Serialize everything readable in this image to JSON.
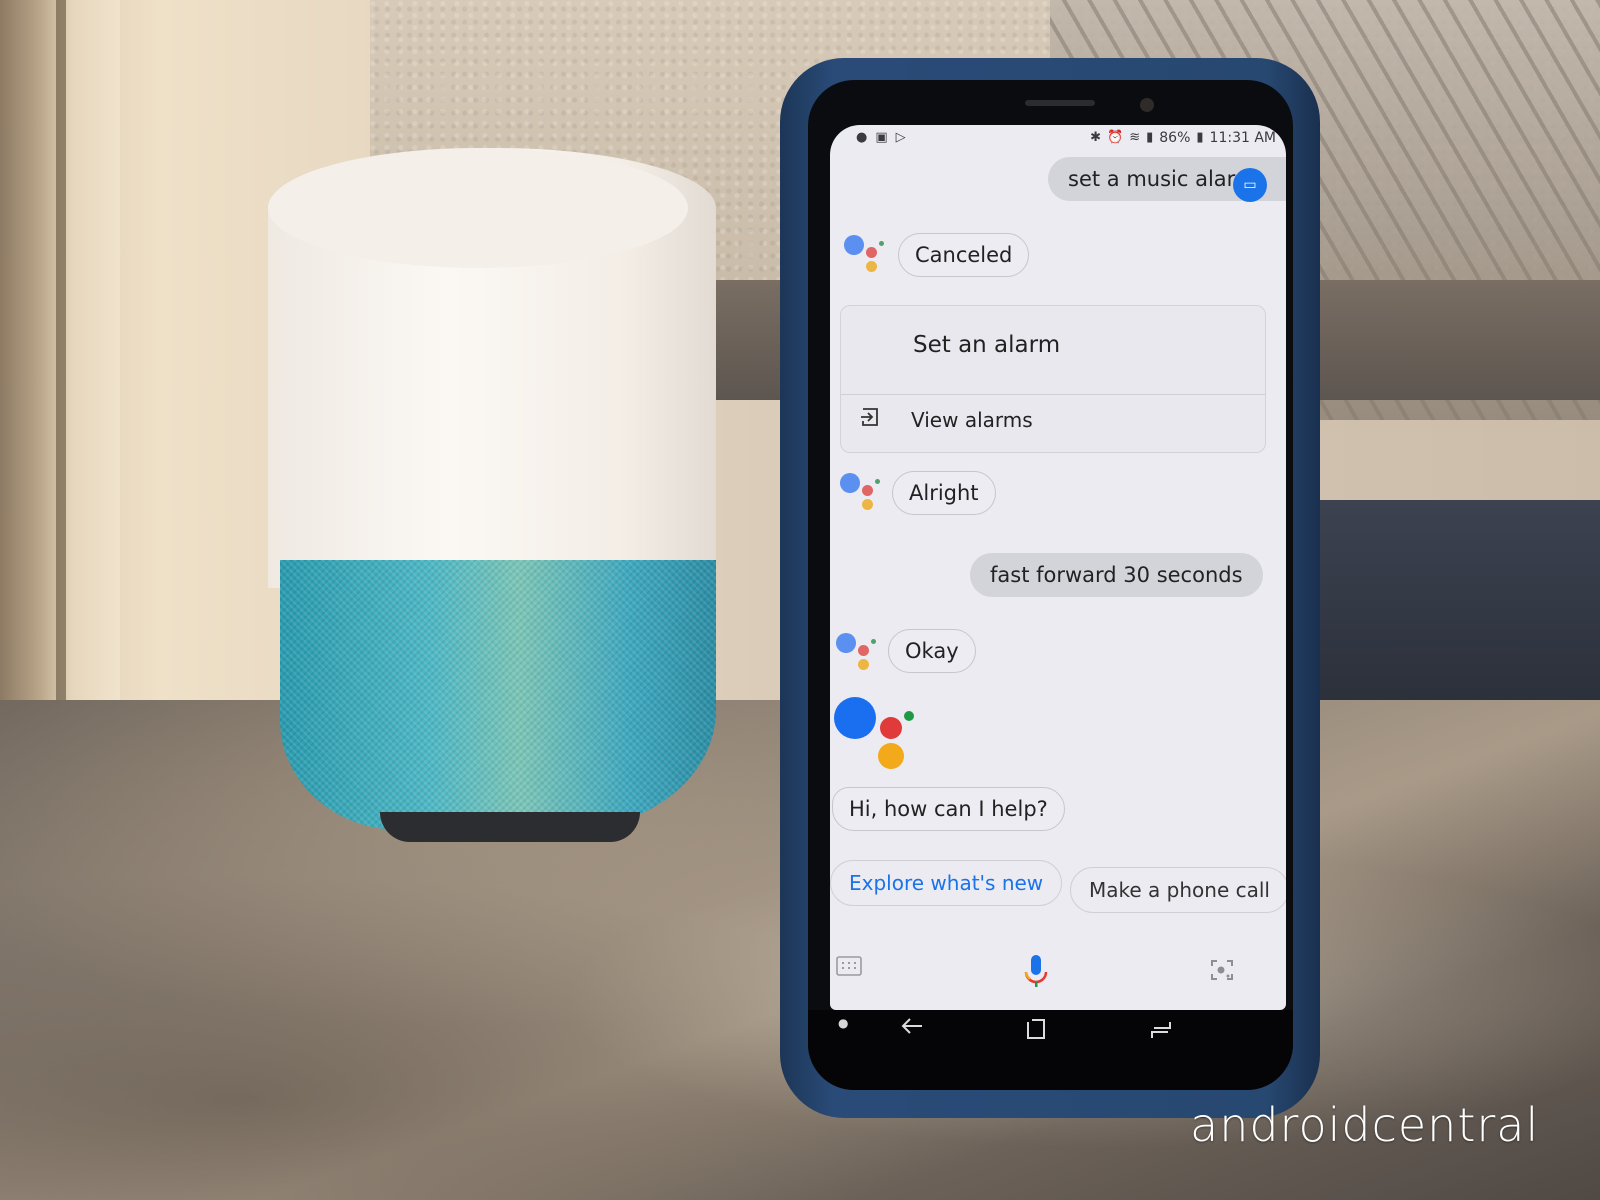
{
  "scene": {
    "description": "Google Home speaker next to a Samsung phone showing Google Assistant",
    "watermark": "androidcentral"
  },
  "phone": {
    "statusbar": {
      "left_icons": [
        "music-icon",
        "image-icon",
        "play-store-icon"
      ],
      "right_icons": [
        "bluetooth-icon",
        "alarm-icon",
        "wifi-icon",
        "signal-icon",
        "battery-icon"
      ],
      "battery": "86%",
      "time": "11:31 AM"
    },
    "conversation": [
      {
        "role": "user",
        "text": "set a music alarm"
      },
      {
        "role": "assistant",
        "text": "Canceled"
      },
      {
        "role": "card",
        "title": "Set an alarm",
        "link": "View alarms"
      },
      {
        "role": "assistant",
        "text": "Alright"
      },
      {
        "role": "user",
        "text": "fast forward 30 seconds"
      },
      {
        "role": "assistant",
        "text": "Okay"
      },
      {
        "role": "assistant",
        "text": "Hi, how can I help?"
      }
    ],
    "suggestions": [
      "Explore what's new",
      "Make a phone call"
    ],
    "bottom_bar": {
      "keyboard_icon": "keyboard-icon",
      "mic_icon": "mic-icon",
      "lens_icon": "lens-icon"
    },
    "navbar": [
      "back-icon",
      "home-icon",
      "recents-icon"
    ],
    "colors": {
      "blue": "#4285F4",
      "red": "#EA4335",
      "yellow": "#FBBC05",
      "green": "#34A853",
      "link": "#1a73e8"
    }
  }
}
